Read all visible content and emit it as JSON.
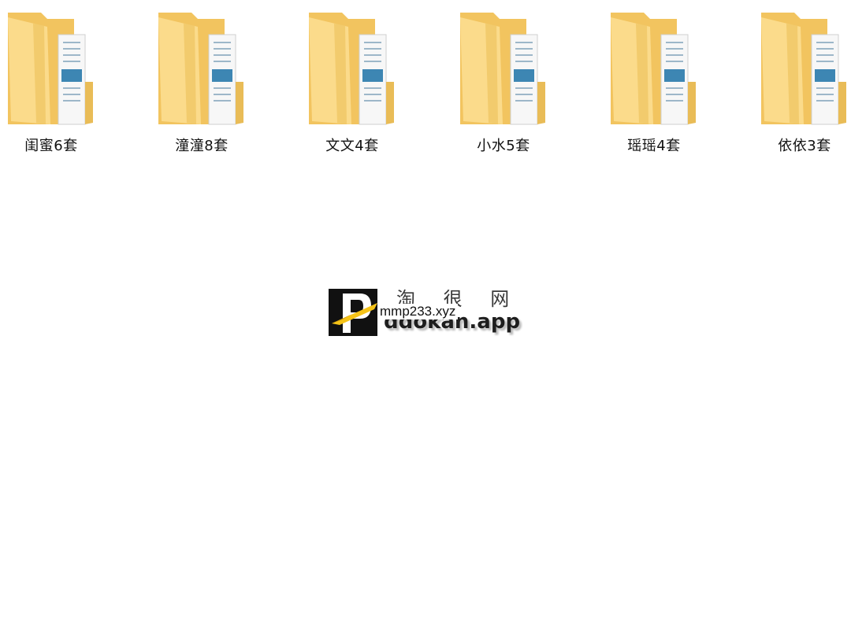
{
  "folders": [
    {
      "label": "闺蜜6套",
      "icon": "folder-icon"
    },
    {
      "label": "潼潼8套",
      "icon": "folder-icon"
    },
    {
      "label": "文文4套",
      "icon": "folder-icon"
    },
    {
      "label": "小水5套",
      "icon": "folder-icon"
    },
    {
      "label": "瑶瑶4套",
      "icon": "folder-icon"
    },
    {
      "label": "依依3套",
      "icon": "folder-icon"
    }
  ],
  "watermark": {
    "cn_text": "淘 很 网",
    "en_text": "ddokan.app",
    "url_text": "mmp233.xyz"
  },
  "colors": {
    "folder_back": "#f3c764",
    "folder_front": "#fbdb8b",
    "paper_blue": "#3d86b3",
    "logo_black": "#111111",
    "logo_yellow": "#f5c318"
  }
}
